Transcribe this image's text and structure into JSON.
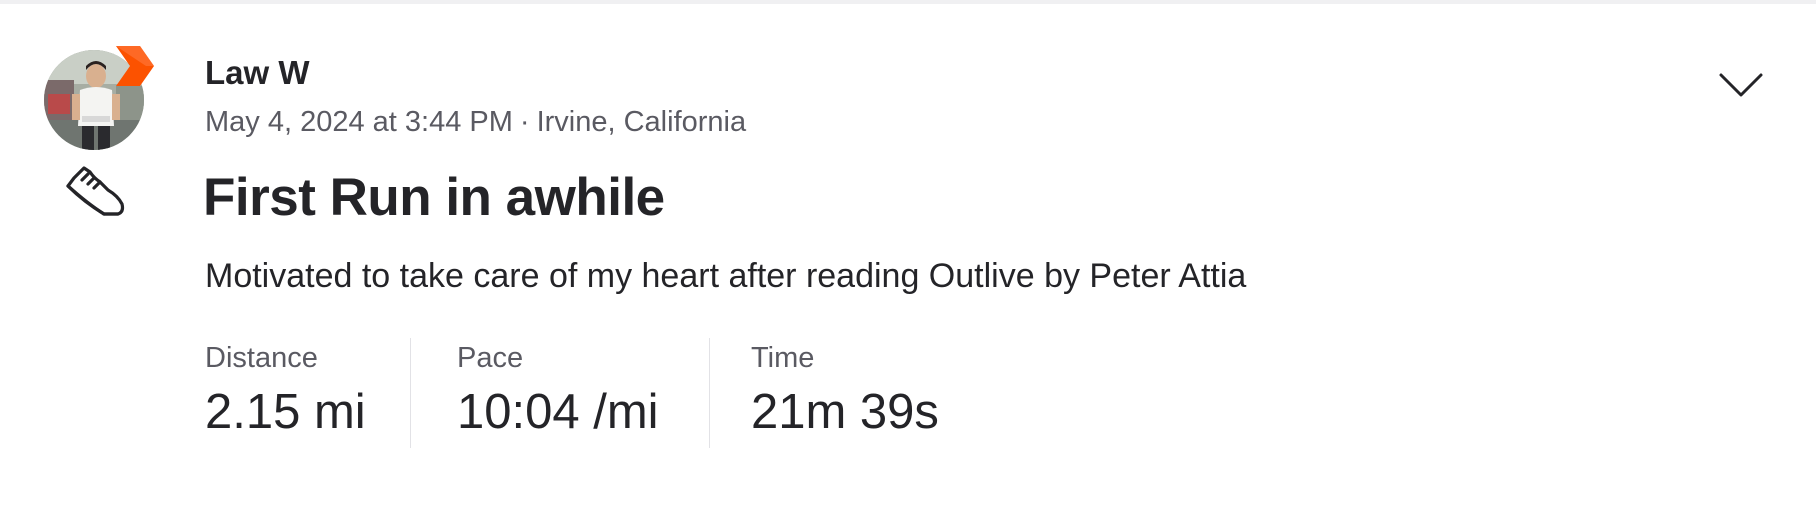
{
  "activity": {
    "athlete_name": "Law W",
    "date_time": "May 4, 2024 at 3:44 PM",
    "separator": "·",
    "location": "Irvine, California",
    "title": "First Run in awhile",
    "description": "Motivated to take care of my heart after reading Outlive by Peter Attia",
    "sport_icon": "running-shoe-icon",
    "badge_icon": "strava-subscriber-badge-icon",
    "menu_icon": "chevron-down-icon",
    "stats": [
      {
        "label": "Distance",
        "value": "2.15 mi"
      },
      {
        "label": "Pace",
        "value": "10:04 /mi"
      },
      {
        "label": "Time",
        "value": "21m 39s"
      }
    ]
  },
  "colors": {
    "brand_orange": "#fc5200",
    "text_primary": "#242428",
    "text_secondary": "#5a5a62",
    "divider": "#e2e2e6"
  }
}
